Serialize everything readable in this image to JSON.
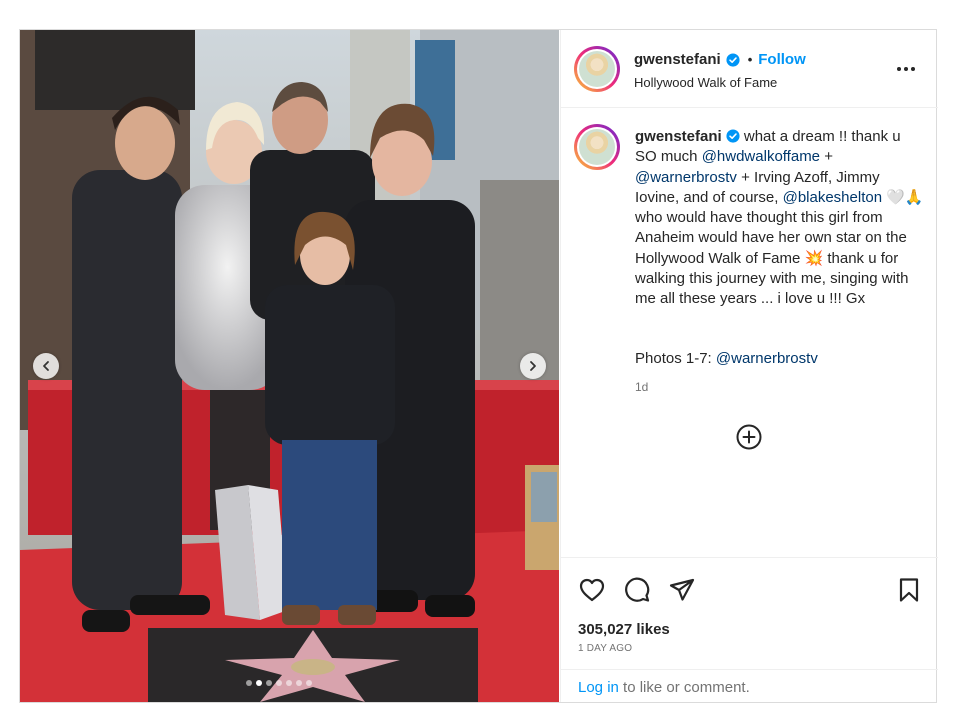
{
  "post": {
    "username": "gwenstefani",
    "follow_label": "Follow",
    "bullet": "•",
    "location": "Hollywood Walk of Fame",
    "caption": {
      "username": "gwenstefani",
      "t1": " what a dream !! thank u SO much ",
      "m1": "@hwdwalkoffame",
      "t2": " + ",
      "m2": "@warnerbrostv",
      "t3": " + Irving Azoff, Jimmy Iovine, and of course, ",
      "m3": "@blakeshelton",
      "t4": " 🤍🙏 who would have thought this girl from Anaheim would have her own star on the Hollywood Walk of Fame 💥 thank u for walking this journey with me, singing with me all these years ... i love u !!! Gx",
      "photos_prefix": "Photos 1-7: ",
      "photos_mention": "@warnerbrostv",
      "time": "1d"
    },
    "likes": "305,027 likes",
    "date": "1 DAY AGO",
    "login_link": "Log in",
    "login_rest": " to like or comment.",
    "carousel": {
      "count": 7,
      "active": 2
    }
  },
  "icons": [
    "verified-badge-icon",
    "more-options-icon",
    "add-comment-icon",
    "heart-icon",
    "comment-icon",
    "share-icon",
    "bookmark-icon",
    "chevron-left-icon",
    "chevron-right-icon"
  ],
  "colors": {
    "accent": "#0095f6",
    "mention": "#00376b",
    "muted": "#737373",
    "border": "#dbdbdb",
    "text": "#262626"
  }
}
